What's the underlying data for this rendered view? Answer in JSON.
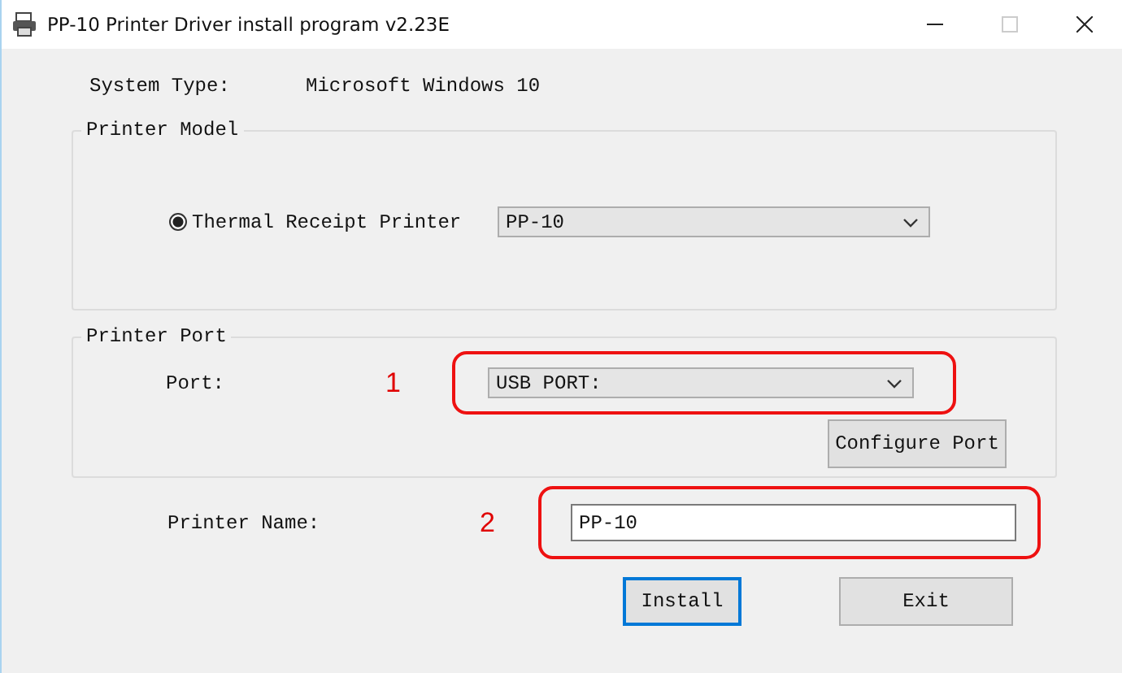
{
  "window": {
    "title": "PP-10 Printer Driver install program v2.23E",
    "maximize_disabled": true
  },
  "system_type": {
    "label": "System Type:",
    "value": "Microsoft Windows 10"
  },
  "printer_model": {
    "legend": "Printer Model",
    "options": [
      {
        "label": "Thermal Receipt Printer",
        "selected": true
      }
    ],
    "model_select": "PP-10"
  },
  "printer_port": {
    "legend": "Printer Port",
    "port_label": "Port:",
    "annotation": "1",
    "port_select": "USB PORT:",
    "configure_button": "Configure Port"
  },
  "printer_name": {
    "label": "Printer Name:",
    "annotation": "2",
    "value": "PP-10"
  },
  "buttons": [
    {
      "label": "Install",
      "focused": true
    },
    {
      "label": "Exit",
      "focused": false
    }
  ]
}
